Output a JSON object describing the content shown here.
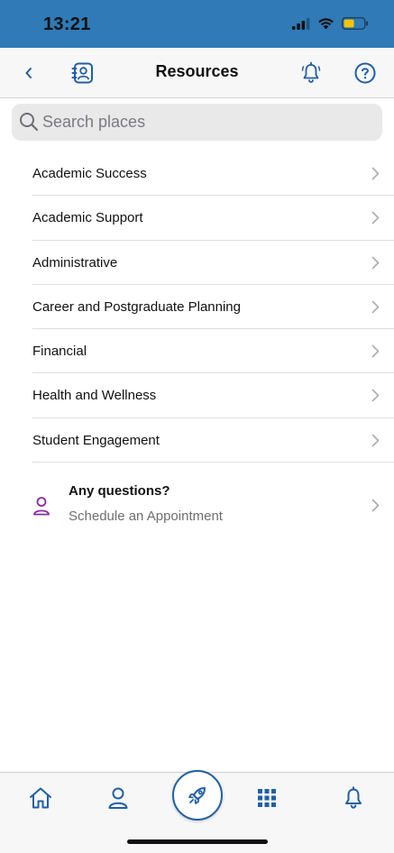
{
  "status_bar": {
    "time": "13:21"
  },
  "nav": {
    "title": "Resources"
  },
  "search": {
    "placeholder": "Search places",
    "value": ""
  },
  "categories": [
    {
      "label": "Academic Success"
    },
    {
      "label": "Academic Support"
    },
    {
      "label": "Administrative"
    },
    {
      "label": "Career and Postgraduate Planning"
    },
    {
      "label": "Financial"
    },
    {
      "label": "Health and Wellness"
    },
    {
      "label": "Student Engagement"
    }
  ],
  "appointment": {
    "title": "Any questions?",
    "subtitle": "Schedule an Appointment"
  },
  "tab_bar": {
    "items": [
      "home-icon",
      "profile-icon",
      "rocket-icon",
      "apps-grid-icon",
      "bell-icon"
    ]
  },
  "colors": {
    "status_bar": "#2f7ab7",
    "accent": "#1f5fa5",
    "appointment_icon": "#8b2aa0",
    "battery": "#f2c500"
  }
}
